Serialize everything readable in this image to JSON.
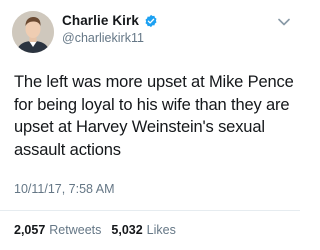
{
  "author": {
    "display_name": "Charlie Kirk",
    "handle": "@charliekirk11",
    "verified_color": "#1da1f2"
  },
  "tweet": {
    "text": "The left was more upset at Mike Pence for being loyal to his wife than they are upset at Harvey Weinstein's sexual assault actions",
    "timestamp": "10/11/17, 7:58 AM"
  },
  "stats": {
    "retweets_count": "2,057",
    "retweets_label": "Retweets",
    "likes_count": "5,032",
    "likes_label": "Likes"
  },
  "icons": [
    "verified-badge-icon",
    "chevron-down-icon"
  ]
}
